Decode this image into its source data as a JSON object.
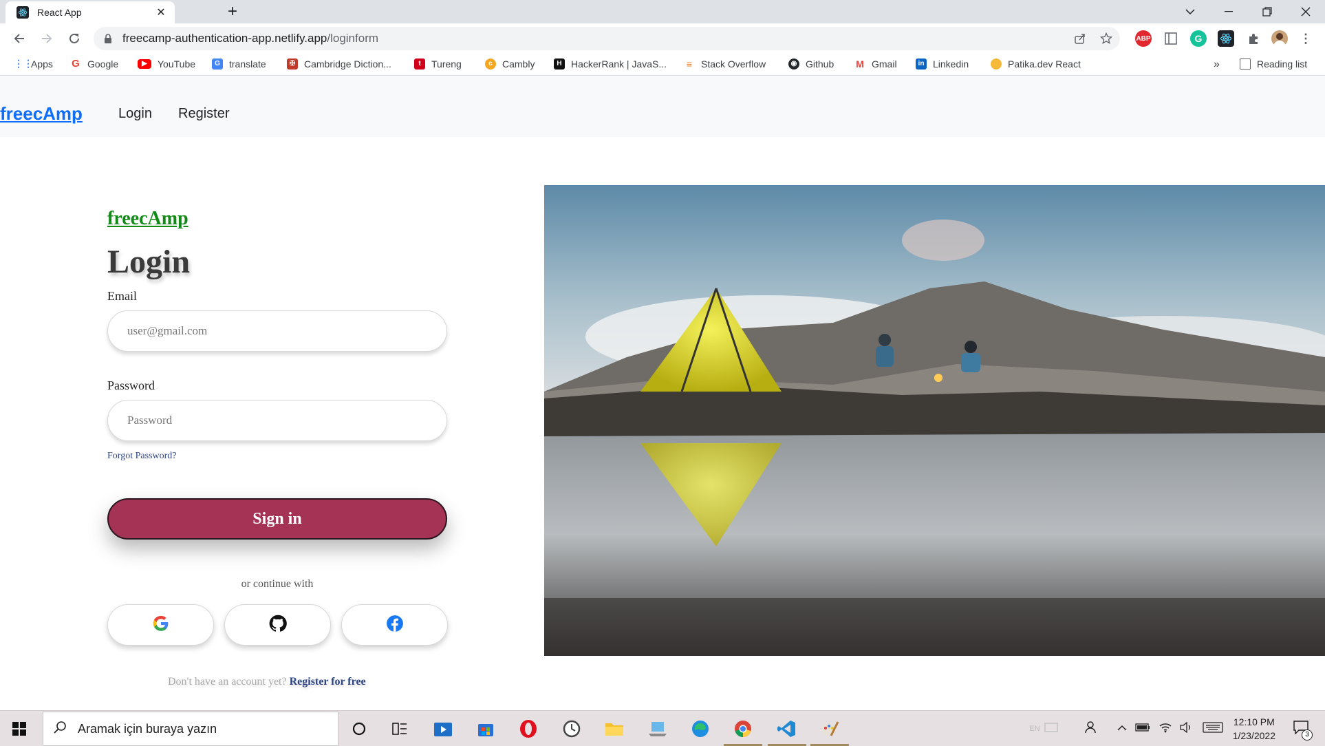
{
  "browser": {
    "tab_title": "React App",
    "tab_close": "✕",
    "new_tab": "+",
    "url_host": "freecamp-authentication-app.netlify.app",
    "url_path": "/loginform",
    "bookmarks": [
      {
        "label": "Apps",
        "icon": "apps-grid-icon",
        "color": "#4285f4"
      },
      {
        "label": "Google",
        "icon": "google-icon",
        "color": "#ea4335"
      },
      {
        "label": "YouTube",
        "icon": "youtube-icon",
        "color": "#ff0000"
      },
      {
        "label": "translate",
        "icon": "translate-icon",
        "color": "#4285f4"
      },
      {
        "label": "Cambridge Diction...",
        "icon": "cambridge-icon",
        "color": "#c0392b"
      },
      {
        "label": "Tureng",
        "icon": "tureng-icon",
        "color": "#d0021b"
      },
      {
        "label": "Cambly",
        "icon": "cambly-icon",
        "color": "#f5a623"
      },
      {
        "label": "HackerRank | JavaS...",
        "icon": "hackerrank-icon",
        "color": "#111111"
      },
      {
        "label": "Stack Overflow",
        "icon": "stackoverflow-icon",
        "color": "#f48024"
      },
      {
        "label": "Github",
        "icon": "github-icon",
        "color": "#24292e"
      },
      {
        "label": "Gmail",
        "icon": "gmail-icon",
        "color": "#ea4335"
      },
      {
        "label": "Linkedin",
        "icon": "linkedin-icon",
        "color": "#0a66c2"
      },
      {
        "label": "Patika.dev React",
        "icon": "patika-icon",
        "color": "#f5b93a"
      }
    ],
    "bookmarks_more": "»",
    "reading_list": "Reading list",
    "extensions": [
      {
        "name": "adblock-icon",
        "text": "ABP",
        "color": "#e0282e"
      },
      {
        "name": "sidebar-ext-icon",
        "text": "",
        "color": "#5f6368"
      },
      {
        "name": "grammarly-icon",
        "text": "G",
        "color": "#15c39a"
      },
      {
        "name": "react-devtools-icon",
        "text": "",
        "color": "#20232a"
      }
    ]
  },
  "app": {
    "brand": "freecAmp",
    "nav_login": "Login",
    "nav_register": "Register",
    "form": {
      "brand": "freecAmp",
      "title": "Login",
      "email_label": "Email",
      "email_placeholder": "user@gmail.com",
      "password_label": "Password",
      "password_placeholder": "Password",
      "forgot": "Forgot Password?",
      "signin": "Sign in",
      "or_continue": "or continue with",
      "no_account": "Don't have an account yet?",
      "register_free": "Register for free"
    },
    "colors": {
      "brand_blue": "#0d6efd",
      "form_brand_green": "#128a18",
      "signin_bg": "#a53355",
      "link_navy": "#2e4482"
    }
  },
  "taskbar": {
    "search_placeholder": "Aramak için buraya yazın",
    "lang": "EN",
    "time": "12:10 PM",
    "date": "1/23/2022",
    "notifications": "3"
  }
}
